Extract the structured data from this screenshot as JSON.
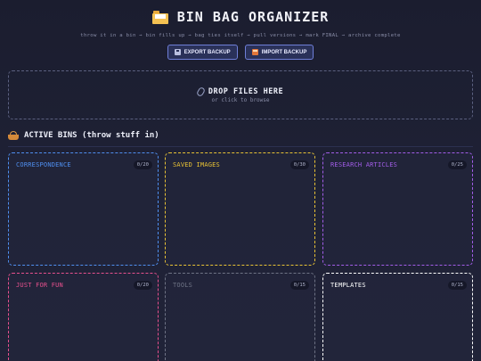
{
  "header": {
    "title": "BIN BAG ORGANIZER",
    "subtitle": "throw it in a bin → bin fills up → bag ties itself → pull versions → mark FINAL → archive complete",
    "title_icon": "folder-icon"
  },
  "toolbar": {
    "export_label": "EXPORT BACKUP",
    "export_icon": "floppy-disk-icon",
    "import_label": "IMPORT BACKUP",
    "import_icon": "inbox-tray-icon"
  },
  "dropzone": {
    "title": "DROP FILES HERE",
    "subtitle": "or click to browse",
    "icon": "paperclip-icon"
  },
  "section": {
    "title": "ACTIVE BINS (throw stuff in)",
    "icon": "basket-icon"
  },
  "bins": [
    {
      "name": "CORRESPONDENCE",
      "count": "0/20",
      "color": "#4f8ff0"
    },
    {
      "name": "SAVED IMAGES",
      "count": "0/30",
      "color": "#e8c235"
    },
    {
      "name": "RESEARCH ARTICLES",
      "count": "0/25",
      "color": "#a25de8"
    },
    {
      "name": "JUST FOR FUN",
      "count": "0/20",
      "color": "#e8508e"
    },
    {
      "name": "TOOLS",
      "count": "0/15",
      "color": "#6f7385"
    },
    {
      "name": "TEMPLATES",
      "count": "0/15",
      "color": "#ffffff"
    }
  ]
}
